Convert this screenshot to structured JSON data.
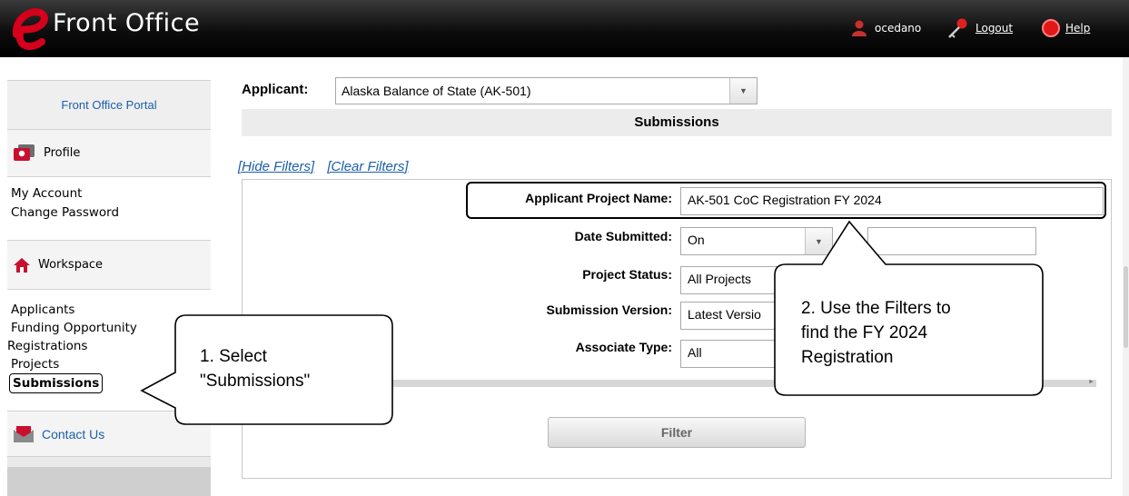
{
  "header": {
    "app_name": "Front Office",
    "username": "ocedano",
    "logout_label": "Logout",
    "help_label": "Help"
  },
  "sidebar": {
    "portal_label": "Front Office Portal",
    "profile_title": "Profile",
    "profile_links": [
      "My Account",
      "Change Password"
    ],
    "workspace_title": "Workspace",
    "workspace_links": [
      "Applicants",
      "Funding Opportunity",
      "Registrations",
      "Projects"
    ],
    "active_link": "Submissions",
    "contact_label": "Contact Us"
  },
  "main": {
    "applicant_label": "Applicant:",
    "applicant_value": "Alaska Balance of State (AK-501)",
    "section_title": "Submissions",
    "hide_filters": "[Hide Filters]",
    "clear_filters": "[Clear Filters]",
    "filter_button": "Filter",
    "filters": {
      "project_name_label": "Applicant Project Name:",
      "project_name_value": "AK-501 CoC Registration FY 2024",
      "date_label": "Date Submitted:",
      "date_value": "On",
      "status_label": "Project Status:",
      "status_value": "All Projects",
      "version_label": "Submission Version:",
      "version_value": "Latest Versio",
      "associate_label": "Associate Type:",
      "associate_value": "All"
    }
  },
  "callouts": {
    "step1_line1": "1. Select",
    "step1_line2": "\"Submissions\"",
    "step2_line1": "2. Use the Filters to",
    "step2_line2": "find the FY 2024",
    "step2_line3": "Registration"
  },
  "colors": {
    "link_blue": "#1d5fa9",
    "brand_red": "#d6001c",
    "header_black": "#000000"
  },
  "icons": [
    "e-logo-icon",
    "user-icon",
    "key-icon",
    "help-icon",
    "profile-icon",
    "home-icon",
    "mail-icon",
    "chevron-down-icon"
  ]
}
